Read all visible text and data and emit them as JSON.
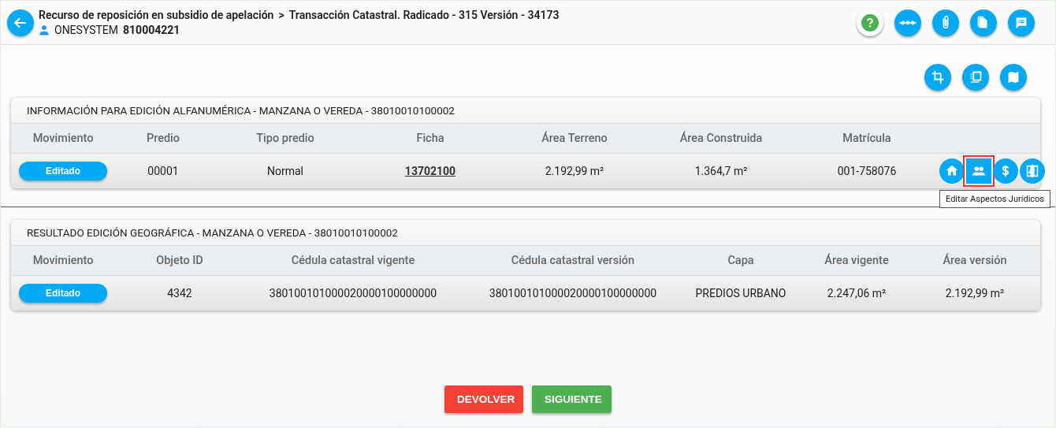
{
  "header": {
    "breadcrumb": [
      "Recurso de reposición en subsidio de apelación",
      "Transacción Catastral. Radicado - 315 Versión - 34173"
    ],
    "separator": ">",
    "user": {
      "name": "ONESYSTEM",
      "id": "810004221"
    },
    "tools": [
      {
        "kind": "help"
      },
      {
        "kind": "flow"
      },
      {
        "kind": "clip"
      },
      {
        "kind": "file"
      },
      {
        "kind": "comment"
      }
    ]
  },
  "map_tools": [
    {
      "kind": "crop"
    },
    {
      "kind": "layers"
    },
    {
      "kind": "map"
    }
  ],
  "tables": [
    {
      "title": "INFORMACIÓN PARA EDICIÓN ALFANUMÉRICA - MANZANA O VEREDA - 38010010100002",
      "columns": [
        "Movimiento",
        "Predio",
        "Tipo predio",
        "Ficha",
        "Área Terreno",
        "Área Construida",
        "Matrícula"
      ],
      "rows": [
        {
          "cells": [
            {
              "kind": "status",
              "text": "Editado"
            },
            {
              "kind": "text",
              "text": "00001"
            },
            {
              "kind": "text",
              "text": "Normal"
            },
            {
              "kind": "link",
              "text": "13702100"
            },
            {
              "kind": "text",
              "text": "2.192,99 m²"
            },
            {
              "kind": "text",
              "text": "1.364,7 m²"
            },
            {
              "kind": "text",
              "text": "001-758076"
            }
          ],
          "actions": [
            {
              "kind": "home",
              "highlighted": false
            },
            {
              "kind": "people",
              "highlighted": true,
              "tooltip": "Editar Aspectos Jurídicos"
            },
            {
              "kind": "dollar",
              "highlighted": false
            },
            {
              "kind": "compare",
              "highlighted": false
            }
          ]
        }
      ]
    },
    {
      "title": "RESULTADO EDICIÓN GEOGRÁFICA - MANZANA O VEREDA - 38010010100002",
      "columns": [
        "Movimiento",
        "Objeto ID",
        "Cédula catastral vigente",
        "Cédula catastral versión",
        "Capa",
        "Área vigente",
        "Área versión"
      ],
      "rows": [
        {
          "cells": [
            {
              "kind": "status",
              "text": "Editado"
            },
            {
              "kind": "text",
              "text": "4342"
            },
            {
              "kind": "text",
              "text": "380100101000020000100000000"
            },
            {
              "kind": "text",
              "text": "380100101000020000100000000"
            },
            {
              "kind": "text",
              "text": "PREDIOS URBANO"
            },
            {
              "kind": "text",
              "text": "2.247,06 m²"
            },
            {
              "kind": "text",
              "text": "2.192,99 m²"
            }
          ]
        }
      ]
    }
  ],
  "buttons": [
    {
      "label": "DEVOLVER",
      "kind": "danger"
    },
    {
      "label": "SIGUIENTE",
      "kind": "success"
    }
  ]
}
